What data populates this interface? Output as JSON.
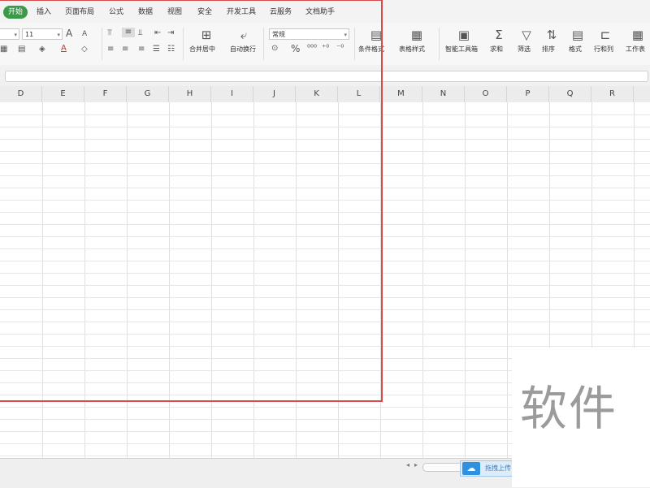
{
  "menu": {
    "tabs": [
      {
        "label": "开始",
        "active": true
      },
      {
        "label": "插入"
      },
      {
        "label": "页面布局"
      },
      {
        "label": "公式"
      },
      {
        "label": "数据"
      },
      {
        "label": "视图"
      },
      {
        "label": "安全"
      },
      {
        "label": "开发工具"
      },
      {
        "label": "云服务"
      },
      {
        "label": "文档助手"
      }
    ]
  },
  "ribbon": {
    "font_size_value": "11",
    "number_format_value": "常规",
    "merge_center_label": "合并居中",
    "wrap_text_label": "自动换行",
    "conditional_format_label": "条件格式",
    "table_style_label": "表格样式",
    "smart_toolbox_label": "智能工具箱",
    "sum_label": "求和",
    "filter_label": "筛选",
    "sort_label": "排序",
    "format_label": "格式",
    "rows_cols_label": "行和列",
    "worksheet_label": "工作表",
    "percent_symbol": "%",
    "increase_font_glyph": "A",
    "decrease_font_glyph": "A",
    "font_color_glyph": "A"
  },
  "columns": [
    "D",
    "E",
    "F",
    "G",
    "H",
    "I",
    "J",
    "K",
    "L",
    "M",
    "N",
    "O",
    "P",
    "Q",
    "R"
  ],
  "bottom": {
    "upload_label": "拖拽上传"
  },
  "watermark": "软件",
  "colors": {
    "accent_green": "#3a9a4a",
    "selection_red": "#d94a4a",
    "upload_blue": "#2f8fe0"
  }
}
